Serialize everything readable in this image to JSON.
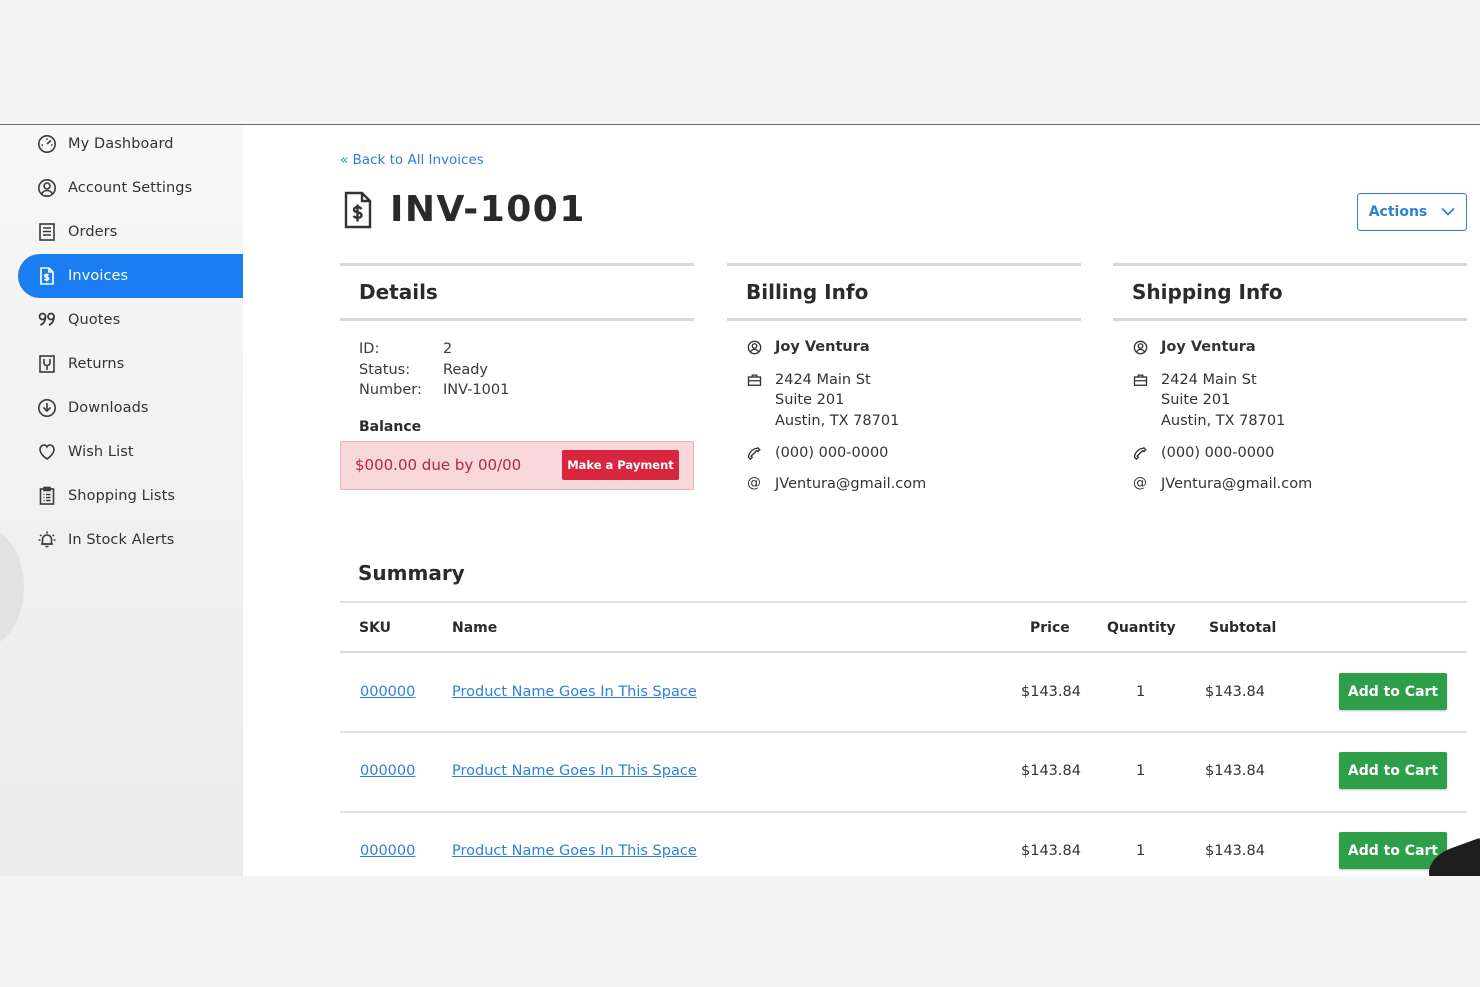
{
  "sidebar": {
    "items": [
      {
        "label": "My Dashboard",
        "icon": "dashboard-icon",
        "active": false
      },
      {
        "label": "Account Settings",
        "icon": "user-circle-icon",
        "active": false
      },
      {
        "label": "Orders",
        "icon": "receipt-icon",
        "active": false
      },
      {
        "label": "Invoices",
        "icon": "invoice-icon",
        "active": true
      },
      {
        "label": "Quotes",
        "icon": "quote-icon",
        "active": false
      },
      {
        "label": "Returns",
        "icon": "return-icon",
        "active": false
      },
      {
        "label": "Downloads",
        "icon": "download-icon",
        "active": false
      },
      {
        "label": "Wish List",
        "icon": "heart-icon",
        "active": false
      },
      {
        "label": "Shopping Lists",
        "icon": "clipboard-list-icon",
        "active": false
      },
      {
        "label": "In Stock Alerts",
        "icon": "bell-alert-icon",
        "active": false
      }
    ]
  },
  "header": {
    "back_link": "« Back to All Invoices",
    "title": "INV-1001",
    "actions_label": "Actions"
  },
  "details": {
    "heading": "Details",
    "rows": [
      {
        "key": "ID:",
        "value": "2"
      },
      {
        "key": "Status:",
        "value": "Ready"
      },
      {
        "key": "Number:",
        "value": "INV-1001"
      }
    ],
    "balance_label": "Balance",
    "balance_due": "$000.00 due by 00/00",
    "pay_button": "Make a Payment"
  },
  "billing": {
    "heading": "Billing Info",
    "name": "Joy Ventura",
    "address": [
      "2424 Main St",
      "Suite 201",
      "Austin, TX 78701"
    ],
    "phone": "(000) 000-0000",
    "email": "JVentura@gmail.com"
  },
  "shipping": {
    "heading": "Shipping Info",
    "name": "Joy Ventura",
    "address": [
      "2424 Main St",
      "Suite 201",
      "Austin, TX 78701"
    ],
    "phone": "(000) 000-0000",
    "email": "JVentura@gmail.com"
  },
  "summary": {
    "heading": "Summary",
    "columns": [
      "SKU",
      "Name",
      "Price",
      "Quantity",
      "Subtotal"
    ],
    "rows": [
      {
        "sku": "000000",
        "name": "Product Name Goes In This Space",
        "price": "$143.84",
        "qty": "1",
        "subtotal": "$143.84",
        "action": "Add to Cart"
      },
      {
        "sku": "000000",
        "name": "Product Name Goes In This Space",
        "price": "$143.84",
        "qty": "1",
        "subtotal": "$143.84",
        "action": "Add to Cart"
      },
      {
        "sku": "000000",
        "name": "Product Name Goes In This Space",
        "price": "$143.84",
        "qty": "1",
        "subtotal": "$143.84",
        "action": "Add to Cart"
      }
    ]
  },
  "colors": {
    "accent": "#1a7ef2",
    "link": "#2f7fd8",
    "danger": "#d7263d",
    "success": "#2e9e48"
  }
}
